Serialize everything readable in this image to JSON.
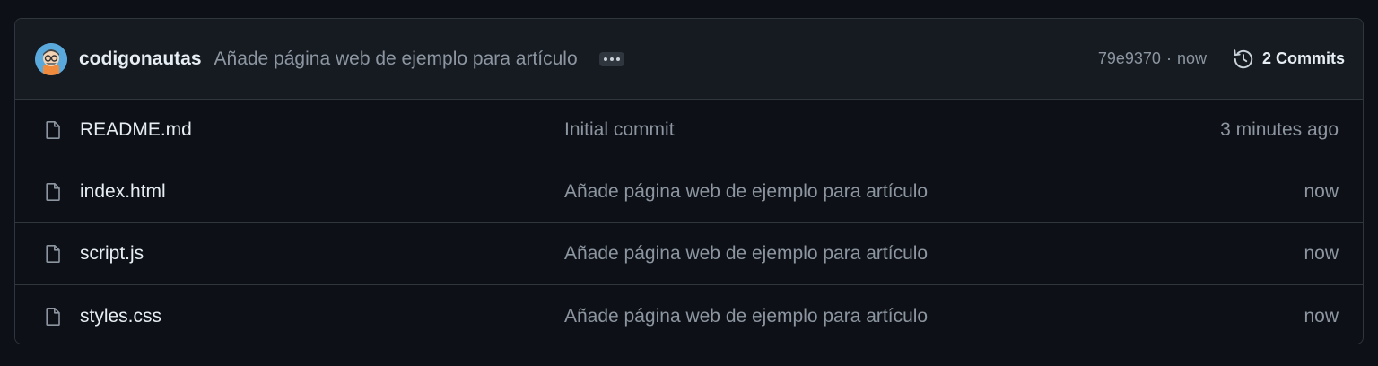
{
  "latest_commit": {
    "author": "codigonautas",
    "message": "Añade página web de ejemplo para artículo",
    "hash": "79e9370",
    "separator": "·",
    "time": "now",
    "commits_label": "2 Commits"
  },
  "files": [
    {
      "name": "README.md",
      "message": "Initial commit",
      "time": "3 minutes ago"
    },
    {
      "name": "index.html",
      "message": "Añade página web de ejemplo para artículo",
      "time": "now"
    },
    {
      "name": "script.js",
      "message": "Añade página web de ejemplo para artículo",
      "time": "now"
    },
    {
      "name": "styles.css",
      "message": "Añade página web de ejemplo para artículo",
      "time": "now"
    }
  ],
  "colors": {
    "background": "#0d1117",
    "header_background": "#161b22",
    "border": "#30363d",
    "text_primary": "#e6edf3",
    "text_muted": "#8d96a0"
  },
  "icons": {
    "avatar": "avatar-image",
    "ellipsis": "kebab-horizontal-icon",
    "history": "history-icon",
    "file": "file-icon"
  }
}
